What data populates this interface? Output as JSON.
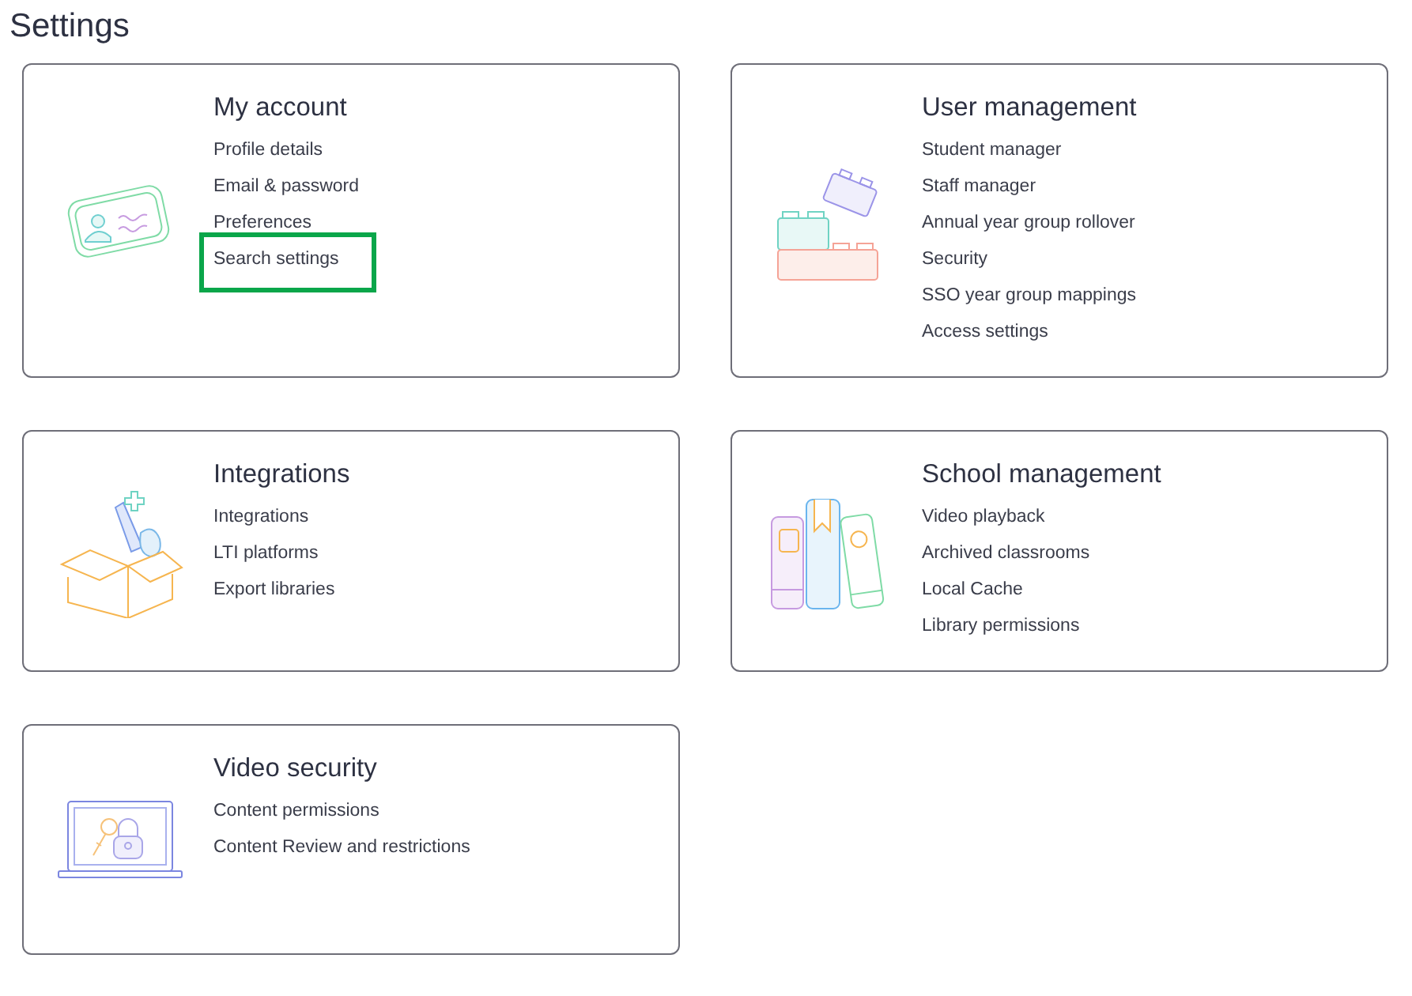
{
  "page": {
    "title": "Settings"
  },
  "cards": [
    {
      "title": "My account",
      "links": [
        {
          "label": "Profile details",
          "highlighted": false
        },
        {
          "label": "Email & password",
          "highlighted": false
        },
        {
          "label": "Preferences",
          "highlighted": false
        },
        {
          "label": "Search settings",
          "highlighted": true
        }
      ]
    },
    {
      "title": "User management",
      "links": [
        {
          "label": "Student manager",
          "highlighted": false
        },
        {
          "label": "Staff manager",
          "highlighted": false
        },
        {
          "label": "Annual year group rollover",
          "highlighted": false
        },
        {
          "label": "Security",
          "highlighted": false
        },
        {
          "label": "SSO year group mappings",
          "highlighted": false
        },
        {
          "label": "Access settings",
          "highlighted": false
        }
      ]
    },
    {
      "title": "Integrations",
      "links": [
        {
          "label": "Integrations",
          "highlighted": false
        },
        {
          "label": "LTI platforms",
          "highlighted": false
        },
        {
          "label": "Export libraries",
          "highlighted": false
        }
      ]
    },
    {
      "title": "School management",
      "links": [
        {
          "label": "Video playback",
          "highlighted": false
        },
        {
          "label": "Archived classrooms",
          "highlighted": false
        },
        {
          "label": "Local Cache",
          "highlighted": false
        },
        {
          "label": "Library permissions",
          "highlighted": false
        }
      ]
    },
    {
      "title": "Video security",
      "links": [
        {
          "label": "Content permissions",
          "highlighted": false
        },
        {
          "label": "Content Review and restrictions",
          "highlighted": false
        }
      ]
    }
  ]
}
